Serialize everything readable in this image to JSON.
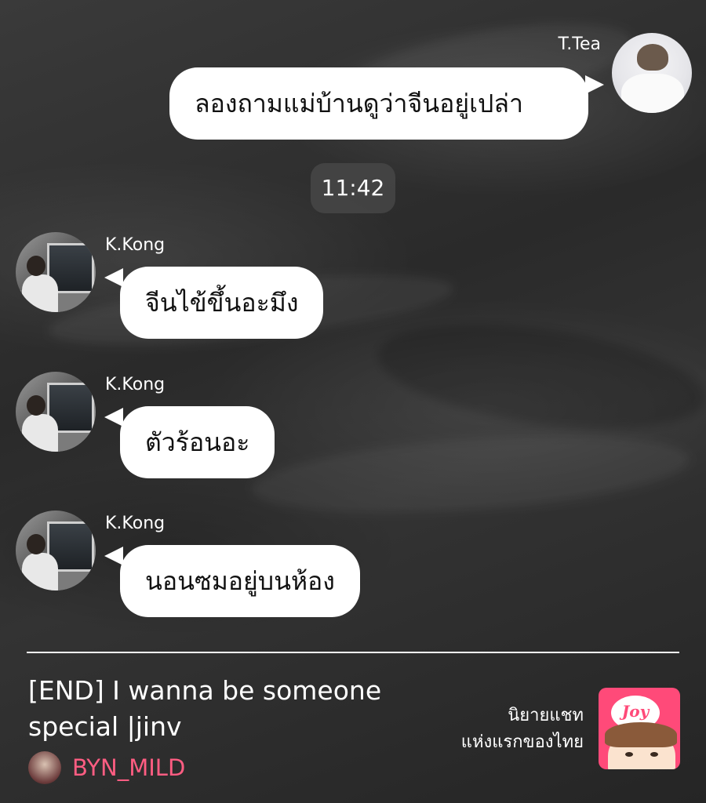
{
  "messages": [
    {
      "sender": "T.Tea",
      "side": "right",
      "text": "ลองถามแม่บ้านดูว่าจีนอยู่เปล่า"
    },
    {
      "type": "timestamp",
      "text": "11:42"
    },
    {
      "sender": "K.Kong",
      "side": "left",
      "text": "จีนไข้ขึ้นอะมึง"
    },
    {
      "sender": "K.Kong",
      "side": "left",
      "text": "ตัวร้อนอะ"
    },
    {
      "sender": "K.Kong",
      "side": "left",
      "text": "นอนซมอยู่บนห้อง"
    }
  ],
  "footer": {
    "story_title": "[END] I wanna be someone special |jinv",
    "author": "BYN_MILD",
    "tagline_line1": "นิยายแชท",
    "tagline_line2": "แห่งแรกของไทย",
    "app_logo": "Joy",
    "author_color": "#ff5d82",
    "app_color": "#ff4a79"
  }
}
